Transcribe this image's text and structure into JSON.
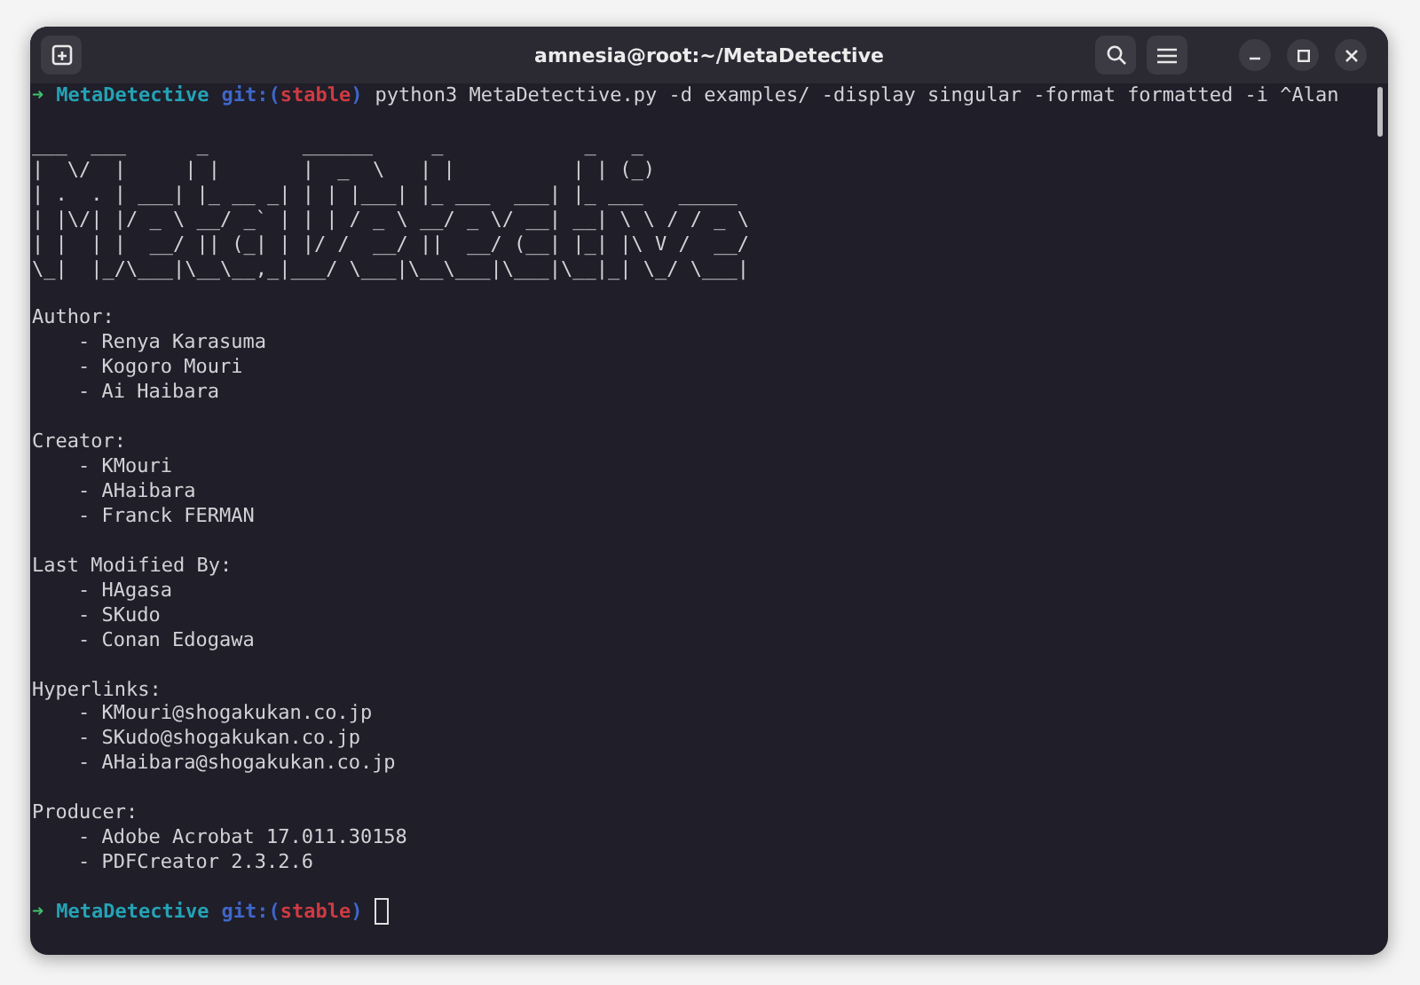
{
  "window": {
    "title": "amnesia@root:~/MetaDetective"
  },
  "prompts": [
    {
      "arrow": "➜",
      "directory": "MetaDetective",
      "git_open": "git:(",
      "branch": "stable",
      "git_close": ")",
      "command": "python3 MetaDetective.py -d examples/ -display singular -format formatted -i ^Alan"
    },
    {
      "arrow": "➜",
      "directory": "MetaDetective",
      "git_open": "git:(",
      "branch": "stable",
      "git_close": ")",
      "cursor": true
    }
  ],
  "ascii_art": [
    "___  ___      _        ______     _            _   _",
    "|  \\/  |     | |       |  _  \\   | |          | | (_)",
    "| .  . | ___| |_ __ _| | | |___| |_ ___  ___| |_ ___   _____",
    "| |\\/| |/ _ \\ __/ _` | | | / _ \\ __/ _ \\/ __| __| \\ \\ / / _ \\",
    "| |  | |  __/ || (_| | |/ /  __/ ||  __/ (__| |_| |\\ V /  __/",
    "\\_|  |_/\\___|\\__\\__,_|___/ \\___|\\__\\___|\\___|\\__|_| \\_/ \\___|"
  ],
  "sections": [
    {
      "heading": "Author:",
      "items": [
        "- Renya Karasuma",
        "- Kogoro Mouri",
        "- Ai Haibara"
      ]
    },
    {
      "heading": "Creator:",
      "items": [
        "- KMouri",
        "- AHaibara",
        "- Franck FERMAN"
      ]
    },
    {
      "heading": "Last Modified By:",
      "items": [
        "- HAgasa",
        "- SKudo",
        "- Conan Edogawa"
      ]
    },
    {
      "heading": "Hyperlinks:",
      "items": [
        "- KMouri@shogakukan.co.jp",
        "- SKudo@shogakukan.co.jp",
        "- AHaibara@shogakukan.co.jp"
      ]
    },
    {
      "heading": "Producer:",
      "items": [
        "- Adobe Acrobat 17.011.30158",
        "- PDFCreator 2.3.2.6"
      ]
    }
  ]
}
